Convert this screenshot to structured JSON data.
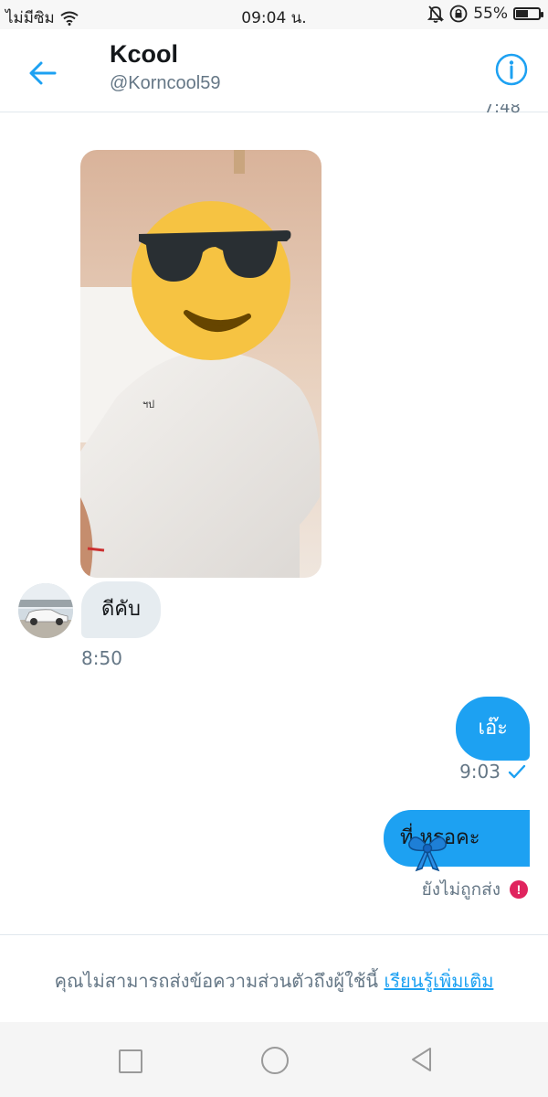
{
  "status_bar": {
    "carrier": "ไม่มีซิม",
    "time": "09:04 น.",
    "battery": "55%"
  },
  "header": {
    "name": "Kcool",
    "handle": "@Korncool59"
  },
  "conversation": {
    "previous_time": "7:48",
    "incoming": {
      "text": "ดีคับ",
      "time": "8:50"
    },
    "outgoing_1": {
      "text": "เอ๊ะ",
      "time": "9:03"
    },
    "outgoing_2": {
      "text": "ที่ หรอคะ",
      "status": "ยังไม่ถูกส่ง"
    }
  },
  "notice": {
    "text": "คุณไม่สามารถส่งข้อความส่วนตัวถึงผู้ใช้นี้",
    "link": "เรียนรู้เพิ่มเติม"
  },
  "colors": {
    "accent": "#1da1f2",
    "error": "#e0245e",
    "muted": "#657786",
    "emoji_face": "#f6c342"
  },
  "icons": [
    "wifi-icon",
    "bell-off-icon",
    "lock-rotation-icon",
    "battery-icon",
    "back-arrow-icon",
    "info-icon",
    "sent-check-icon",
    "error-icon",
    "nav-square-icon",
    "nav-circle-icon",
    "nav-back-icon"
  ]
}
